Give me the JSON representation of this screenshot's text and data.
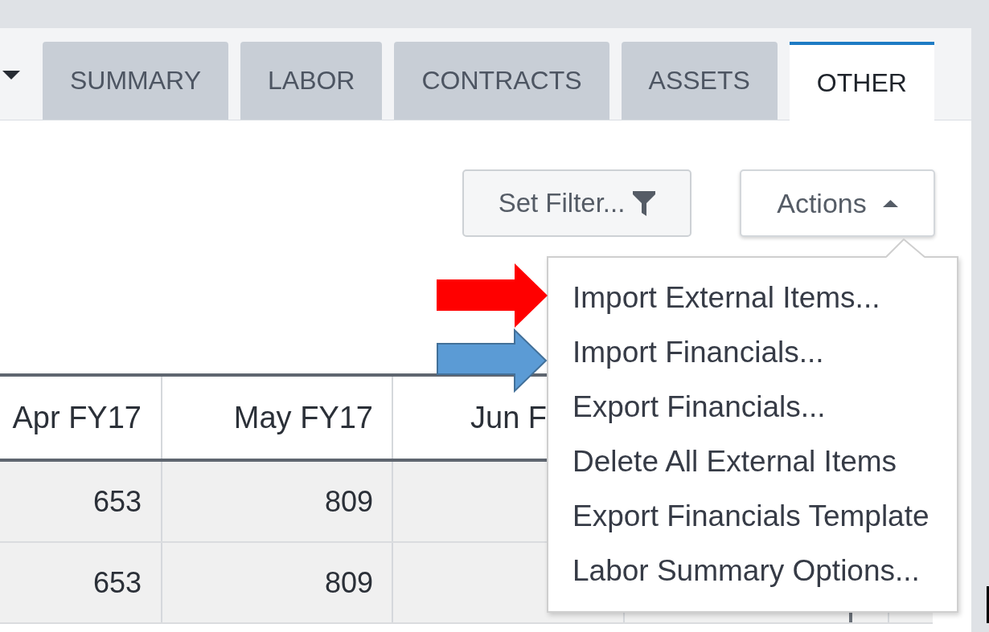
{
  "tabs": [
    {
      "label": "SUMMARY",
      "selected": false
    },
    {
      "label": "LABOR",
      "selected": false
    },
    {
      "label": "CONTRACTS",
      "selected": false
    },
    {
      "label": "ASSETS",
      "selected": false
    },
    {
      "label": "OTHER",
      "selected": true
    }
  ],
  "toolbar": {
    "filter_button": {
      "label": "Set Filter..."
    },
    "actions_button": {
      "label": "Actions",
      "expanded": true
    }
  },
  "actions_menu": {
    "items": [
      "Import External Items...",
      "Import Financials...",
      "Export Financials...",
      "Delete All External Items",
      "Export Financials Template",
      "Labor Summary Options..."
    ]
  },
  "annotation_arrows": [
    {
      "kind": "plain",
      "color": "#ff0000"
    },
    {
      "kind": "outlined",
      "color": "#5b9bd5"
    }
  ],
  "table": {
    "columns": [
      "Apr FY17",
      "May FY17",
      "Jun F"
    ],
    "rows": [
      [
        "653",
        "809"
      ],
      [
        "653",
        "809"
      ]
    ]
  }
}
